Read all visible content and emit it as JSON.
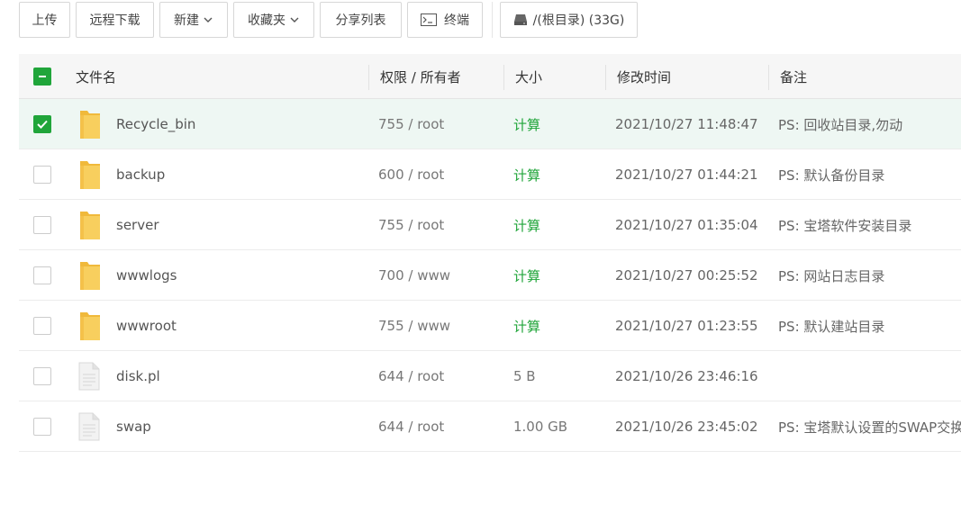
{
  "toolbar": {
    "upload": "上传",
    "remote_download": "远程下载",
    "new": "新建",
    "favorites": "收藏夹",
    "share_list": "分享列表",
    "terminal": "终端",
    "drive": "/(根目录) (33G)"
  },
  "table": {
    "headers": {
      "filename": "文件名",
      "permission": "权限 / 所有者",
      "size": "大小",
      "mtime": "修改时间",
      "note": "备注"
    },
    "rows": [
      {
        "name": "Recycle_bin",
        "type": "folder",
        "perm": "755 / root",
        "size": "计算",
        "size_is_link": true,
        "mtime": "2021/10/27 11:48:47",
        "note": "PS: 回收站目录,勿动",
        "checked": true
      },
      {
        "name": "backup",
        "type": "folder",
        "perm": "600 / root",
        "size": "计算",
        "size_is_link": true,
        "mtime": "2021/10/27 01:44:21",
        "note": "PS: 默认备份目录",
        "checked": false
      },
      {
        "name": "server",
        "type": "folder",
        "perm": "755 / root",
        "size": "计算",
        "size_is_link": true,
        "mtime": "2021/10/27 01:35:04",
        "note": "PS: 宝塔软件安装目录",
        "checked": false
      },
      {
        "name": "wwwlogs",
        "type": "folder",
        "perm": "700 / www",
        "size": "计算",
        "size_is_link": true,
        "mtime": "2021/10/27 00:25:52",
        "note": "PS: 网站日志目录",
        "checked": false
      },
      {
        "name": "wwwroot",
        "type": "folder",
        "perm": "755 / www",
        "size": "计算",
        "size_is_link": true,
        "mtime": "2021/10/27 01:23:55",
        "note": "PS: 默认建站目录",
        "checked": false
      },
      {
        "name": "disk.pl",
        "type": "file",
        "perm": "644 / root",
        "size": "5 B",
        "size_is_link": false,
        "mtime": "2021/10/26 23:46:16",
        "note": "",
        "checked": false
      },
      {
        "name": "swap",
        "type": "file",
        "perm": "644 / root",
        "size": "1.00 GB",
        "size_is_link": false,
        "mtime": "2021/10/26 23:45:02",
        "note": "PS: 宝塔默认设置的SWAP交换分区文件",
        "checked": false
      }
    ]
  },
  "colors": {
    "accent": "#20a53a",
    "selected_row": "#eef7f3",
    "folder": "#f8cf5e"
  },
  "icons": {
    "folder": "folder-icon",
    "file": "file-icon",
    "terminal": "terminal-icon",
    "drive": "drive-icon",
    "chevron": "chevron-down-icon",
    "check": "check-icon",
    "partial": "partial-check-icon"
  }
}
